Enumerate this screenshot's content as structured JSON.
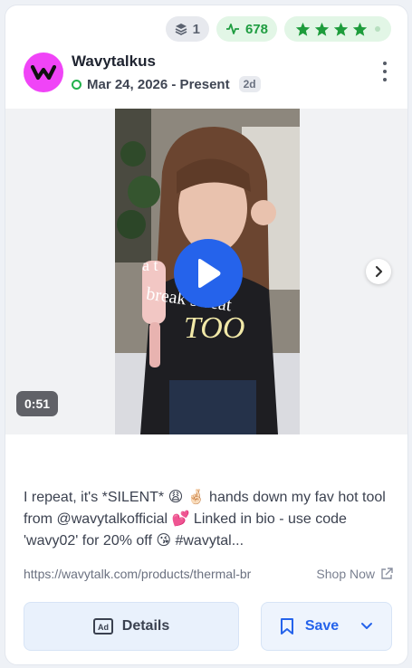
{
  "badges": {
    "layers_count": "1",
    "activity_count": "678",
    "rating": 4,
    "rating_max": 5
  },
  "account": {
    "name": "Wavytalkus",
    "date_range": "Mar 24, 2026 - Present",
    "age": "2d",
    "avatar_letter": "w"
  },
  "media": {
    "duration": "0:51",
    "overlay_text_line1": "a          t",
    "overlay_text_line2": "break   sweat",
    "overlay_text_big": "TOO"
  },
  "post": {
    "caption": "I repeat, it's *SILENT* 😩 🤞🏻 hands down my fav hot tool from @wavytalkofficial 💕 Linked in bio - use code 'wavy02' for 20% off 😘 #wavytal...",
    "url": "https://wavytalk.com/products/thermal-br",
    "shop_label": "Shop Now"
  },
  "actions": {
    "details_label": "Details",
    "save_label": "Save"
  },
  "colors": {
    "brand": "#2563eb",
    "avatar": "#f044f7",
    "success": "#22b14c"
  }
}
